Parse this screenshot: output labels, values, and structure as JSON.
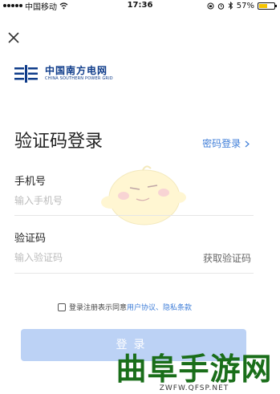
{
  "status_bar": {
    "carrier": "中国移动",
    "time": "17:36",
    "battery": "57%",
    "battery_level": 0.57
  },
  "brand": {
    "name_cn": "中国南方电网",
    "name_en": "CHINA SOUTHERN POWER GRID",
    "color": "#0f3c8a"
  },
  "login": {
    "title": "验证码登录",
    "password_login_link": "密码登录",
    "phone_label": "手机号",
    "phone_placeholder": "输入手机号",
    "phone_value": "",
    "code_label": "验证码",
    "code_placeholder": "输入验证码",
    "code_value": "",
    "get_code_button": "获取验证码",
    "agree_prefix": "登录注册表示同意",
    "agree_links": "用户协议、隐私条款",
    "agree_checked": false,
    "submit_button": "登录"
  },
  "watermark": {
    "cn": "曲阜手游网",
    "url": "ZWFW.QFSP.NET"
  },
  "colors": {
    "accent": "#3f7ed8",
    "button_disabled": "#bcd2f5",
    "watermark_green": "#1a6e1a"
  }
}
